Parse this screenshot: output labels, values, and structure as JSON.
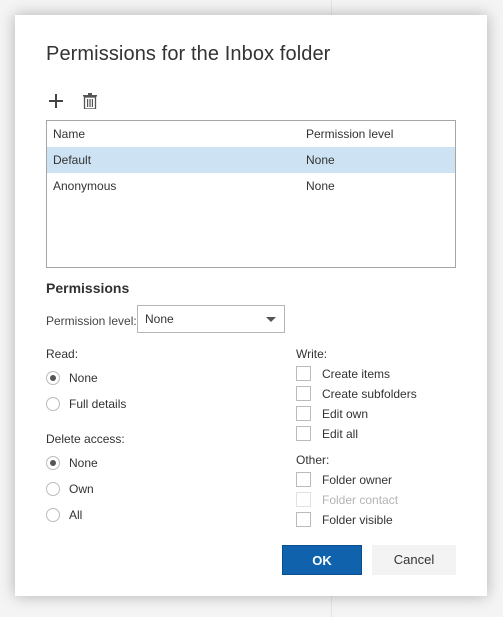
{
  "dialog": {
    "title": "Permissions for the Inbox folder",
    "toolbar": {
      "add_icon": "plus-icon",
      "delete_icon": "trash-icon"
    },
    "grid": {
      "columns": [
        "Name",
        "Permission level"
      ],
      "rows": [
        {
          "name": "Default",
          "level": "None",
          "selected": true
        },
        {
          "name": "Anonymous",
          "level": "None",
          "selected": false
        }
      ]
    },
    "permissions": {
      "heading": "Permissions",
      "level_label": "Permission level:",
      "level_value": "None",
      "read": {
        "label": "Read:",
        "options": [
          {
            "label": "None",
            "checked": true
          },
          {
            "label": "Full details",
            "checked": false
          }
        ]
      },
      "delete": {
        "label": "Delete access:",
        "options": [
          {
            "label": "None",
            "checked": true
          },
          {
            "label": "Own",
            "checked": false
          },
          {
            "label": "All",
            "checked": false
          }
        ]
      },
      "write": {
        "label": "Write:",
        "options": [
          {
            "label": "Create items",
            "checked": false
          },
          {
            "label": "Create subfolders",
            "checked": false
          },
          {
            "label": "Edit own",
            "checked": false
          },
          {
            "label": "Edit all",
            "checked": false
          }
        ]
      },
      "other": {
        "label": "Other:",
        "options": [
          {
            "label": "Folder owner",
            "checked": false,
            "disabled": false
          },
          {
            "label": "Folder contact",
            "checked": false,
            "disabled": true
          },
          {
            "label": "Folder visible",
            "checked": false,
            "disabled": false
          }
        ]
      }
    },
    "buttons": {
      "ok": "OK",
      "cancel": "Cancel"
    },
    "colors": {
      "accent": "#0f62ab",
      "selected_row": "#cde3f3"
    }
  }
}
